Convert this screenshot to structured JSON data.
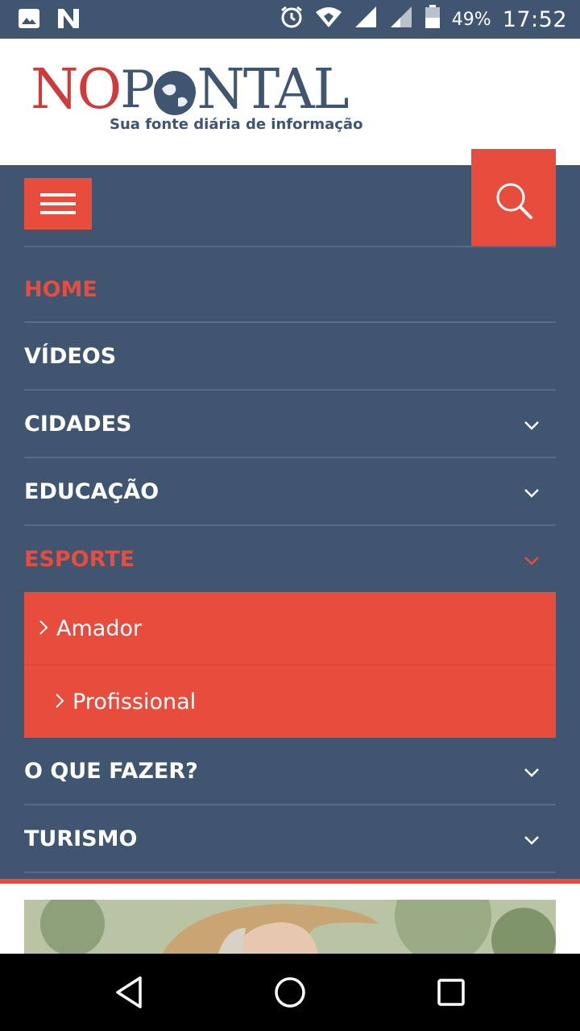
{
  "status_bar": {
    "battery": "49%",
    "time": "17:52",
    "icons": [
      "image-icon",
      "n-app-icon",
      "alarm-icon",
      "wifi-icon",
      "signal-icon",
      "signal-icon-2",
      "battery-icon"
    ]
  },
  "logo": {
    "part1": "NO",
    "part2": "NTAL",
    "tagline": "Sua fonte diária de informação"
  },
  "nav": {
    "items": [
      {
        "label": "HOME",
        "active": true,
        "has_chevron": false
      },
      {
        "label": "VÍDEOS",
        "active": false,
        "has_chevron": false
      },
      {
        "label": "CIDADES",
        "active": false,
        "has_chevron": true
      },
      {
        "label": "EDUCAÇÃO",
        "active": false,
        "has_chevron": true
      },
      {
        "label": "ESPORTE",
        "active": true,
        "has_chevron": true,
        "expanded": true
      }
    ],
    "submenu": [
      {
        "label": "Amador"
      },
      {
        "label": "Profissional"
      }
    ],
    "items_after": [
      {
        "label": "O QUE FAZER?",
        "has_chevron": true
      },
      {
        "label": "TURISMO",
        "has_chevron": true
      }
    ]
  },
  "colors": {
    "accent": "#e74c3c",
    "nav_background": "#3f5570",
    "divider": "#566d86"
  }
}
